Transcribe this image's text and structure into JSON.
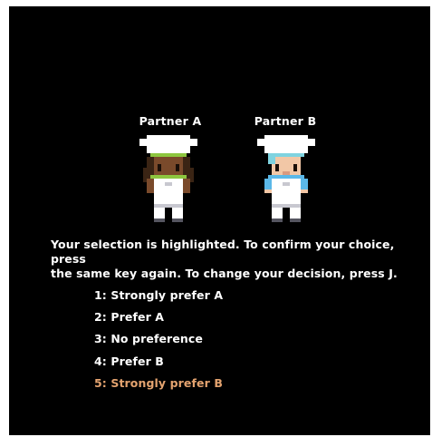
{
  "partners": [
    {
      "label": "Partner A",
      "icon": "chef-dark-skin-green-scarf-icon",
      "skin": "#7a4a2b",
      "hair": "#3a2414",
      "accent": "#8dc63f"
    },
    {
      "label": "Partner B",
      "icon": "chef-light-skin-blue-scarf-icon",
      "skin": "#f2c7a6",
      "hair": "#7fd3e0",
      "accent": "#5bb8e8"
    }
  ],
  "instructions": {
    "line1": "Your selection is highlighted. To confirm your choice, press",
    "line2": "the same key again.  To change your decision, press J."
  },
  "options": [
    {
      "label": "1: Strongly prefer A"
    },
    {
      "label": "2: Prefer A"
    },
    {
      "label": "3: No preference"
    },
    {
      "label": "4: Prefer B"
    },
    {
      "label": "5: Strongly prefer B"
    }
  ],
  "selected_option_index": 4,
  "colors": {
    "background": "#000000",
    "text": "#ffffff",
    "highlight": "#e4a36f"
  }
}
